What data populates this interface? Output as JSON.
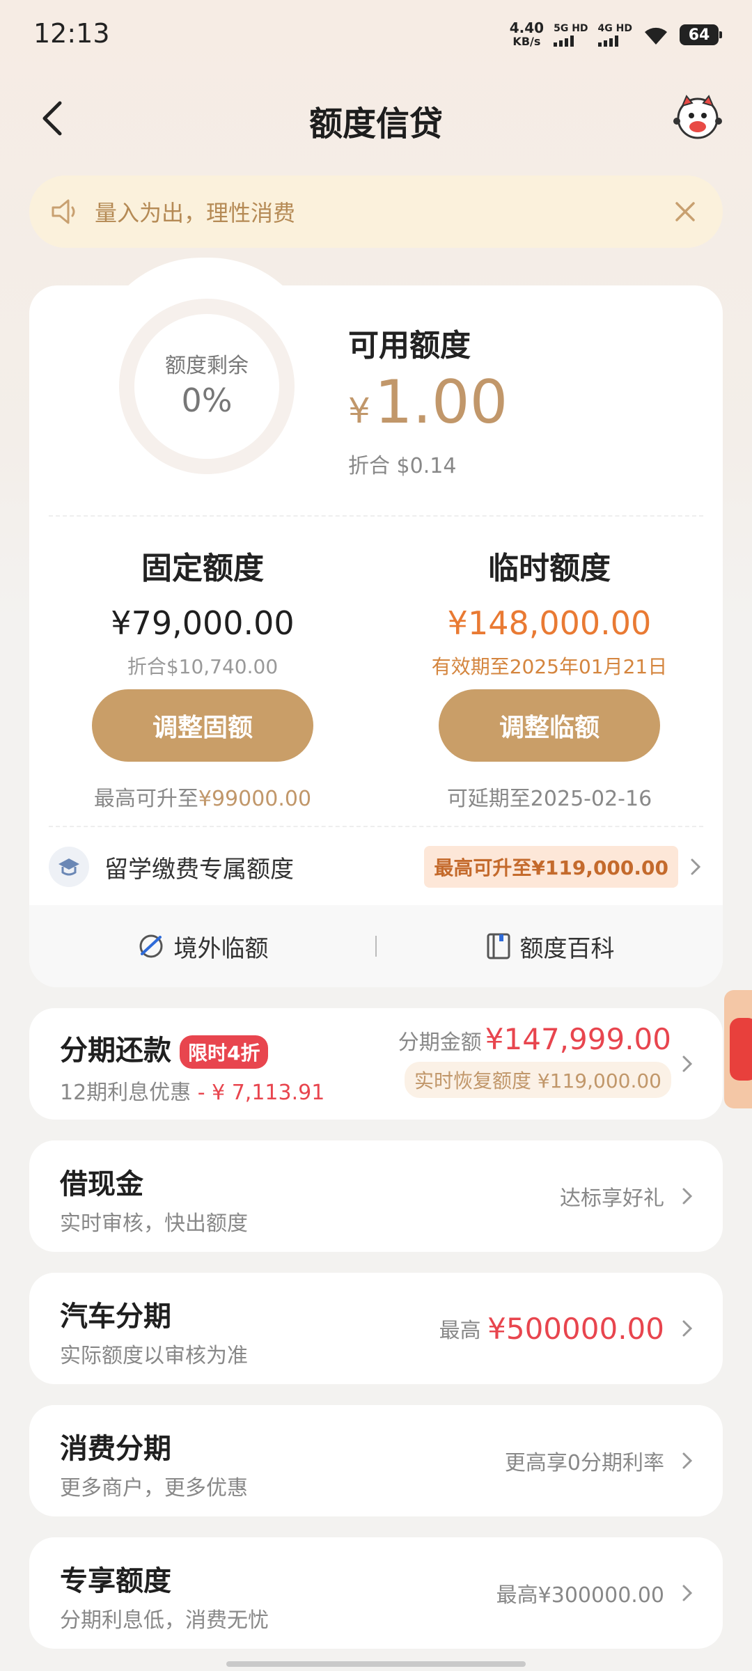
{
  "status": {
    "time": "12:13",
    "netspeed_value": "4.40",
    "netspeed_unit": "KB/s",
    "sim1": "5G HD",
    "sim2": "4G HD",
    "battery": "64"
  },
  "nav": {
    "title": "额度信贷"
  },
  "notice": {
    "text": "量入为出，理性消费"
  },
  "quota": {
    "ring_label": "额度剩余",
    "ring_value": "0%",
    "ring_fraction": 0,
    "available_label": "可用额度",
    "available_currency": "¥",
    "available_amount": "1.00",
    "available_equiv": "折合  $0.14"
  },
  "fixed": {
    "title": "固定额度",
    "amount": "¥79,000.00",
    "sub": "折合$10,740.00",
    "button": "调整固额",
    "foot_prefix": "最高可升至",
    "foot_value": "¥99000.00"
  },
  "temp": {
    "title": "临时额度",
    "amount": "¥148,000.00",
    "sub": "有效期至2025年01月21日",
    "button": "调整临额",
    "foot": "可延期至2025-02-16"
  },
  "study": {
    "label": "留学缴费专属额度",
    "badge": "最高可升至¥119,000.00"
  },
  "card_footer": {
    "left": "境外临额",
    "right": "额度百科"
  },
  "installment": {
    "title": "分期还款",
    "tag": "限时4折",
    "sub_prefix": "12期利息优惠",
    "sub_value": "- ¥ 7,113.91",
    "amount_label": "分期金额",
    "amount": "¥147,999.00",
    "restore": "实时恢复额度 ¥119,000.00"
  },
  "cash": {
    "title": "借现金",
    "sub": "实时审核，快出额度",
    "right": "达标享好礼"
  },
  "car": {
    "title": "汽车分期",
    "sub": "实际额度以审核为准",
    "right_prefix": "最高",
    "right_value": "¥500000.00"
  },
  "consume": {
    "title": "消费分期",
    "sub": "更多商户，更多优惠",
    "right": "更高享0分期利率"
  },
  "exclusive": {
    "title": "专享额度",
    "sub": "分期利息低，消费无忧",
    "right": "最高¥300000.00"
  },
  "colors": {
    "accent": "#c99e68",
    "orange": "#e97a33",
    "red": "#e8454e"
  }
}
